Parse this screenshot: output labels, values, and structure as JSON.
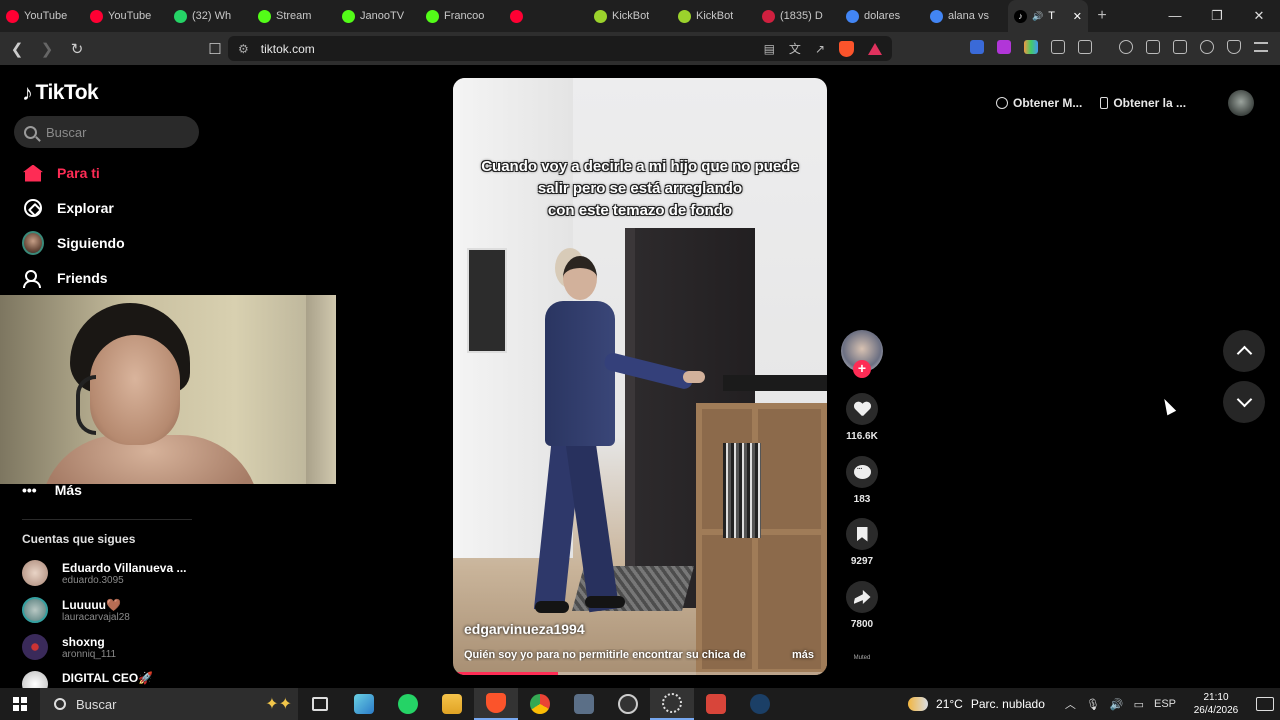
{
  "browser": {
    "tabs": [
      {
        "title": "YouTube",
        "icon": "youtube-icon",
        "color": "#ff0033"
      },
      {
        "title": "YouTube",
        "icon": "youtube-icon",
        "color": "#ff0033"
      },
      {
        "title": "(32) Wh",
        "icon": "whatsapp-icon",
        "color": "#25d366"
      },
      {
        "title": "Stream",
        "icon": "kick-icon",
        "color": "#53fc18"
      },
      {
        "title": "JanooTV",
        "icon": "kick-icon",
        "color": "#53fc18"
      },
      {
        "title": "Francoo",
        "icon": "kick-icon",
        "color": "#53fc18"
      },
      {
        "title": "",
        "icon": "youtube-icon",
        "color": "#ff0033"
      },
      {
        "title": "KickBot",
        "icon": "kickbot-icon",
        "color": "#9bd22c"
      },
      {
        "title": "KickBot",
        "icon": "kickbot-icon",
        "color": "#9bd22c"
      },
      {
        "title": "(1835) D",
        "icon": "tiktok-live-icon",
        "color": "#d0203f"
      },
      {
        "title": "dolares",
        "icon": "google-icon",
        "color": "#4285f4"
      },
      {
        "title": "alana vs",
        "icon": "google-icon",
        "color": "#4285f4"
      }
    ],
    "active_tab": {
      "title": "T",
      "icon": "tiktok-icon"
    },
    "url": "tiktok.com"
  },
  "tiktok": {
    "logo": "TikTok",
    "search_placeholder": "Buscar",
    "nav": [
      {
        "label": "Para ti",
        "active": true
      },
      {
        "label": "Explorar"
      },
      {
        "label": "Siguiendo"
      },
      {
        "label": "Friends"
      }
    ],
    "more_label": "Más",
    "following_heading": "Cuentas que sigues",
    "following": [
      {
        "name": "Eduardo Villanueva ...",
        "user": "eduardo.3095",
        "color": "#c9a494"
      },
      {
        "name": "Luuuuu🤎",
        "user": "lauracarvajal28",
        "color": "#7ba0a6"
      },
      {
        "name": "shoxng",
        "user": "aronniq_111",
        "color": "#3a2a5a"
      },
      {
        "name": "DIGITAL CEO🚀",
        "user": "",
        "color": "#d8d8d8"
      }
    ],
    "top_buttons": {
      "get_coins": "Obtener M...",
      "get_app": "Obtener la ..."
    }
  },
  "video": {
    "caption_lines": [
      "Cuando voy a decirle a mi hijo que no puede",
      "salir pero se está arreglando",
      "con este temazo de fondo"
    ],
    "author": "edgarvinueza1994",
    "description": "Quién soy yo para no permitirle encontrar su chica de",
    "more": "más",
    "progress": 0.28,
    "likes": "116.6K",
    "comments": "183",
    "saves": "9297",
    "shares": "7800",
    "muted_label": "Muted"
  },
  "taskbar": {
    "search": "Buscar",
    "weather_temp": "21°C",
    "weather_desc": "Parc. nublado",
    "lang": "ESP",
    "time": "21:10",
    "date": "26/4/2026"
  }
}
